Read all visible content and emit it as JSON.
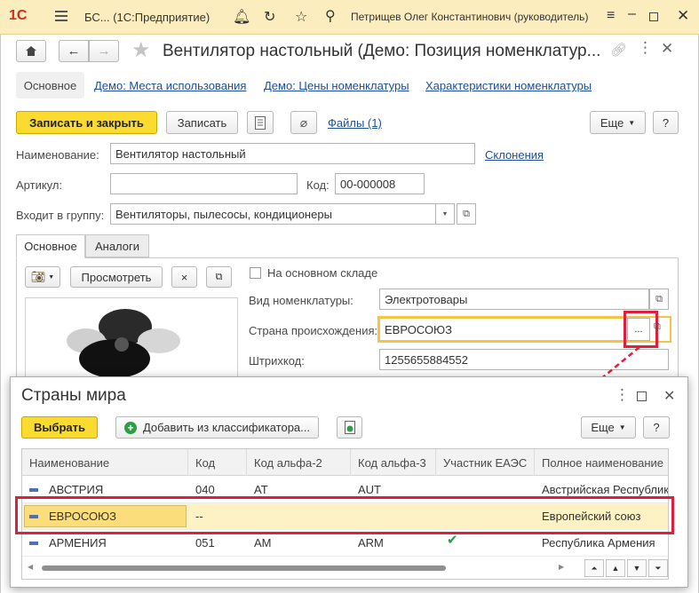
{
  "app": {
    "logo": "1С",
    "title": "БС...  (1С:Предприятие)",
    "user": "Петрищев Олег Константинович (руководитель)"
  },
  "form": {
    "title": "Вентилятор настольный (Демо: Позиция номенклатур...",
    "nav_tabs": [
      "Основное",
      "Демо: Места использования",
      "Демо: Цены номенклатуры",
      "Характеристики номенклатуры"
    ],
    "toolbar": {
      "save_close": "Записать и закрыть",
      "save": "Записать",
      "files": "Файлы (1)",
      "more": "Еще",
      "help": "?"
    },
    "name_label": "Наименование:",
    "name_value": "Вентилятор настольный",
    "declensions": "Склонения",
    "article_label": "Артикул:",
    "article_value": "",
    "code_label": "Код:",
    "code_value": "00-000008",
    "group_label": "Входит в группу:",
    "group_value": "Вентиляторы, пылесосы, кондиционеры",
    "inner_tabs": [
      "Основное",
      "Аналоги"
    ],
    "view_button": "Просмотреть",
    "clear_button": "×",
    "main_warehouse_label": "На основном складе",
    "nomenclature_type_label": "Вид номенклатуры:",
    "nomenclature_type_value": "Электротовары",
    "country_label": "Страна происхождения:",
    "country_value": "ЕВРОСОЮЗ",
    "country_select": "...",
    "barcode_label": "Штрихкод:",
    "barcode_value": "1255655884552"
  },
  "dialog": {
    "title": "Страны мира",
    "select_button": "Выбрать",
    "add_button": "Добавить из классификатора...",
    "more": "Еще",
    "help": "?",
    "columns": [
      "Наименование",
      "Код",
      "Код альфа-2",
      "Код альфа-3",
      "Участник ЕАЭС",
      "Полное наименование"
    ],
    "rows": [
      {
        "name": "АВСТРИЯ",
        "code": "040",
        "alpha2": "AT",
        "alpha3": "AUT",
        "eaeu": "",
        "full": "Австрийская Республик"
      },
      {
        "name": "ЕВРОСОЮЗ",
        "code": "--",
        "alpha2": "",
        "alpha3": "",
        "eaeu": "",
        "full": "Европейский союз"
      },
      {
        "name": "АРМЕНИЯ",
        "code": "051",
        "alpha2": "AM",
        "alpha3": "ARM",
        "eaeu": "✔",
        "full": "Республика Армения"
      }
    ]
  },
  "colors": {
    "accent_yellow": "#fbdb30",
    "highlight_red": "#e0203a",
    "link_blue": "#1a4f9c",
    "check_green": "#23a046"
  }
}
